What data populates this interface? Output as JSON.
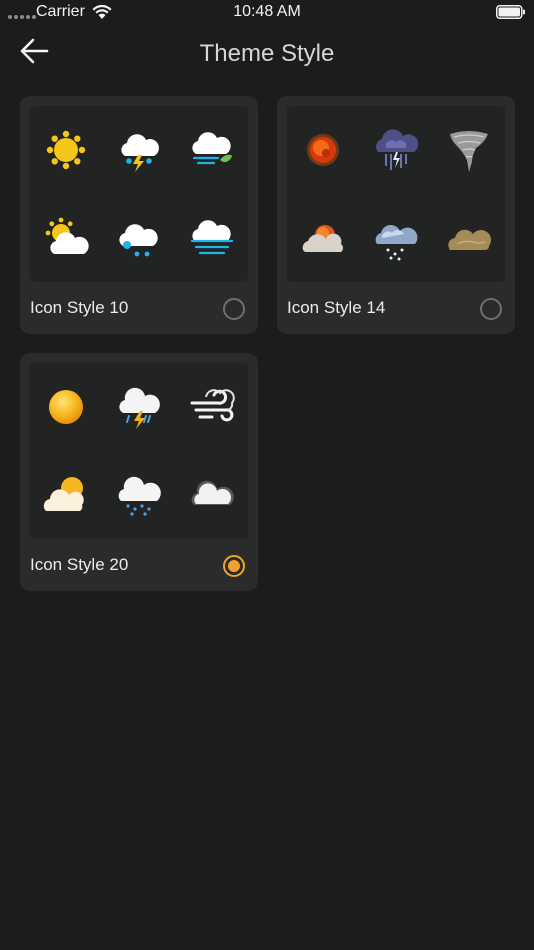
{
  "status_bar": {
    "carrier": "Carrier",
    "time": "10:48 AM"
  },
  "header": {
    "title": "Theme Style",
    "back_icon": "arrow-left-icon"
  },
  "colors": {
    "accent": "#f2a02e",
    "background": "#1b1c1c",
    "card": "#2a2b2b"
  },
  "styles": [
    {
      "label": "Icon Style 10",
      "selected": false,
      "icons": [
        "sun-icon",
        "thunderstorm-icon",
        "windy-cloud-icon",
        "partly-cloudy-icon",
        "snow-cloud-icon",
        "fog-cloud-icon"
      ]
    },
    {
      "label": "Icon Style 14",
      "selected": false,
      "icons": [
        "sun-icon",
        "thunderstorm-icon",
        "tornado-icon",
        "partly-cloudy-icon",
        "snow-cloud-icon",
        "dust-icon"
      ]
    },
    {
      "label": "Icon Style 20",
      "selected": true,
      "icons": [
        "sun-icon",
        "thunderstorm-icon",
        "wind-icon",
        "partly-cloudy-icon",
        "snow-cloud-icon",
        "cloud-icon"
      ]
    }
  ]
}
